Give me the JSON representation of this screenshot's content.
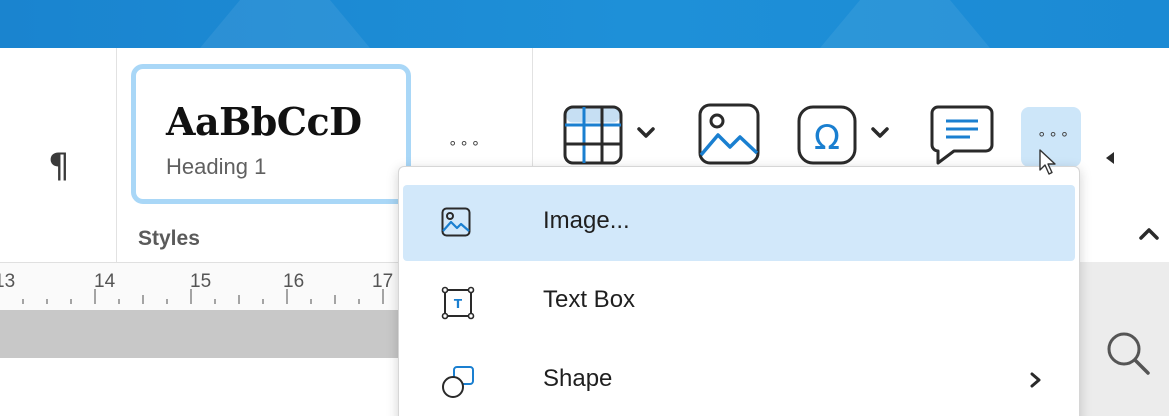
{
  "colors": {
    "accent": "#1e90d8",
    "icon_blue": "#1a7fd0",
    "selected_bg": "#d2e8fa",
    "style_card_border": "#a9d7f7"
  },
  "paragraph": {
    "icon": "pilcrow-icon",
    "glyph": "¶"
  },
  "styles": {
    "sample_text": "AaBbCcD",
    "style_name": "Heading 1",
    "more_label": "∘∘∘",
    "group_label": "Styles"
  },
  "insert_toolbar": {
    "items": [
      {
        "name": "table",
        "icon": "table-icon",
        "has_dropdown": true
      },
      {
        "name": "image",
        "icon": "image-icon",
        "has_dropdown": false
      },
      {
        "name": "special-character",
        "icon": "omega-icon",
        "has_dropdown": true
      },
      {
        "name": "comment",
        "icon": "comment-icon",
        "has_dropdown": false
      }
    ],
    "more_label": "∘∘∘"
  },
  "ruler": {
    "numbers": [
      "13",
      "14",
      "15",
      "16",
      "17"
    ]
  },
  "menu": {
    "items": [
      {
        "label": "Image...",
        "icon": "image-icon",
        "selected": true,
        "has_submenu": false
      },
      {
        "label": "Text Box",
        "icon": "text-box-icon",
        "selected": false,
        "has_submenu": false
      },
      {
        "label": "Shape",
        "icon": "shape-icon",
        "selected": false,
        "has_submenu": true
      }
    ]
  }
}
